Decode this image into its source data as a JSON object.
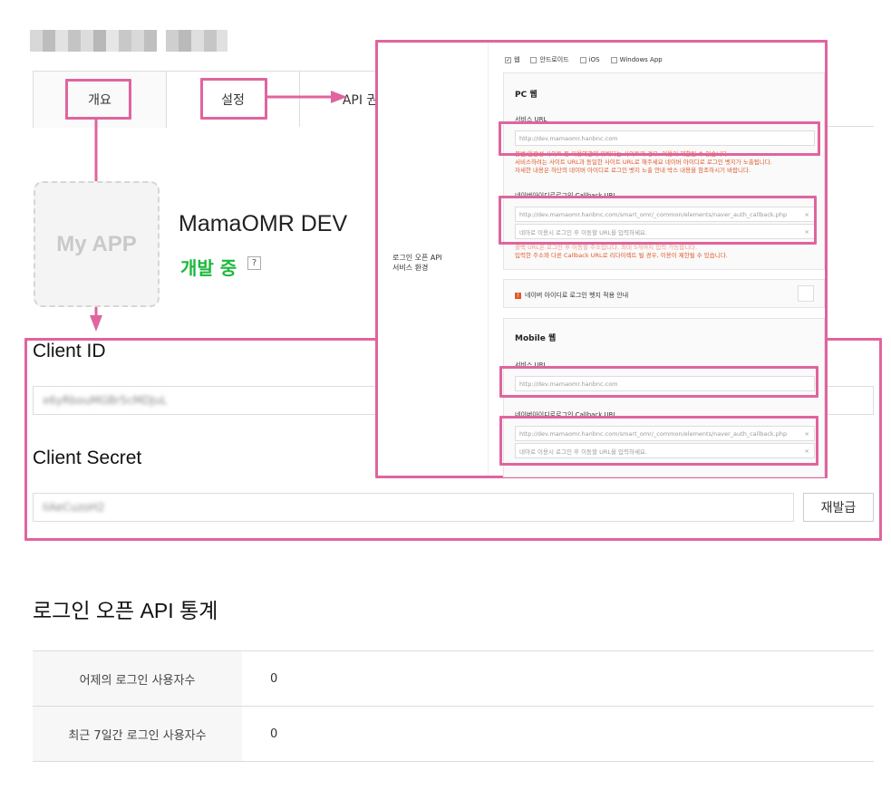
{
  "tabs": [
    {
      "label": "개요"
    },
    {
      "label": "설정"
    },
    {
      "label": "API 권한"
    }
  ],
  "app": {
    "icon_text": "My APP",
    "name": "MamaOMR DEV",
    "status": "개발 중",
    "help": "?"
  },
  "client": {
    "id_label": "Client ID",
    "id_value": "x6yRbouMGBr5cMDJuL",
    "secret_label": "Client Secret",
    "secret_value": "IiAeCuzoH2",
    "reissue_label": "재발급"
  },
  "stats": {
    "title": "로그인 오픈 API 통계",
    "rows": [
      {
        "label": "어제의 로그인 사용자수",
        "value": "0"
      },
      {
        "label": "최근 7일간 로그인 사용자수",
        "value": "0"
      }
    ]
  },
  "panel": {
    "side_label_1": "로그인 오픈 API",
    "side_label_2": "서비스 환경",
    "env_options": [
      {
        "label": "웹",
        "checked": true
      },
      {
        "label": "안드로이드",
        "checked": false
      },
      {
        "label": "iOS",
        "checked": false
      },
      {
        "label": "Windows App",
        "checked": false
      }
    ],
    "pc": {
      "title": "PC 웹",
      "service_url_label": "서비스 URL",
      "service_url_placeholder": "http://dev.mamaomr.hanbnc.com",
      "note_1": "불법/음란성 사이트 등 이용약관에 위배되는 사이트의 경우, 이용이 제한될 수 있습니다.",
      "note_2": "서비스하려는 사이트 URL과 동일한 사이트 URL로 해주세요 네이버 아이디로 로그인 벳지가 노출됩니다.",
      "note_3": "자세한 내용은 하단의 네이버 아이디로 로그인 벳지 노출 안내 박스 내용을 참조하시기 바랍니다.",
      "callback_label": "네이버아이디로로그인 Callback URL",
      "callback_1": "http://dev.mamaomr.hanbnc.com/smart_omr/_common/elements/naver_auth_callback.php",
      "callback_2": "네아로 이용시 로그인 후 이동할 URL을 입력하세요.",
      "callback_note_1": "콜백 URL은 로그인 후 이동할 주소입니다. 최대 5개까지 입력 가능합니다.",
      "callback_note_2": "입력한 주소와 다른 Callback URL로 리다이렉트 될 경우, 이용이 제한될 수 있습니다."
    },
    "badge_notice": "네이버 아이디로 로그인 벳지 적용 안내",
    "mobile": {
      "title": "Mobile 웹",
      "service_url_label": "서비스 URL",
      "service_url_placeholder": "http://dev.mamaomr.hanbnc.com",
      "callback_label": "네이버아이디로로그인 Callback URL",
      "callback_1": "http://dev.mamaomr.hanbnc.com/smart_omr/_common/elements/naver_auth_callback.php",
      "callback_2": "네아로 이용시 로그인 후 이동할 URL을 입력하세요."
    },
    "clear_icon": "×"
  },
  "colors": {
    "highlight": "#e0649e",
    "status_green": "#1db83c",
    "note_red": "#e05a2b"
  }
}
